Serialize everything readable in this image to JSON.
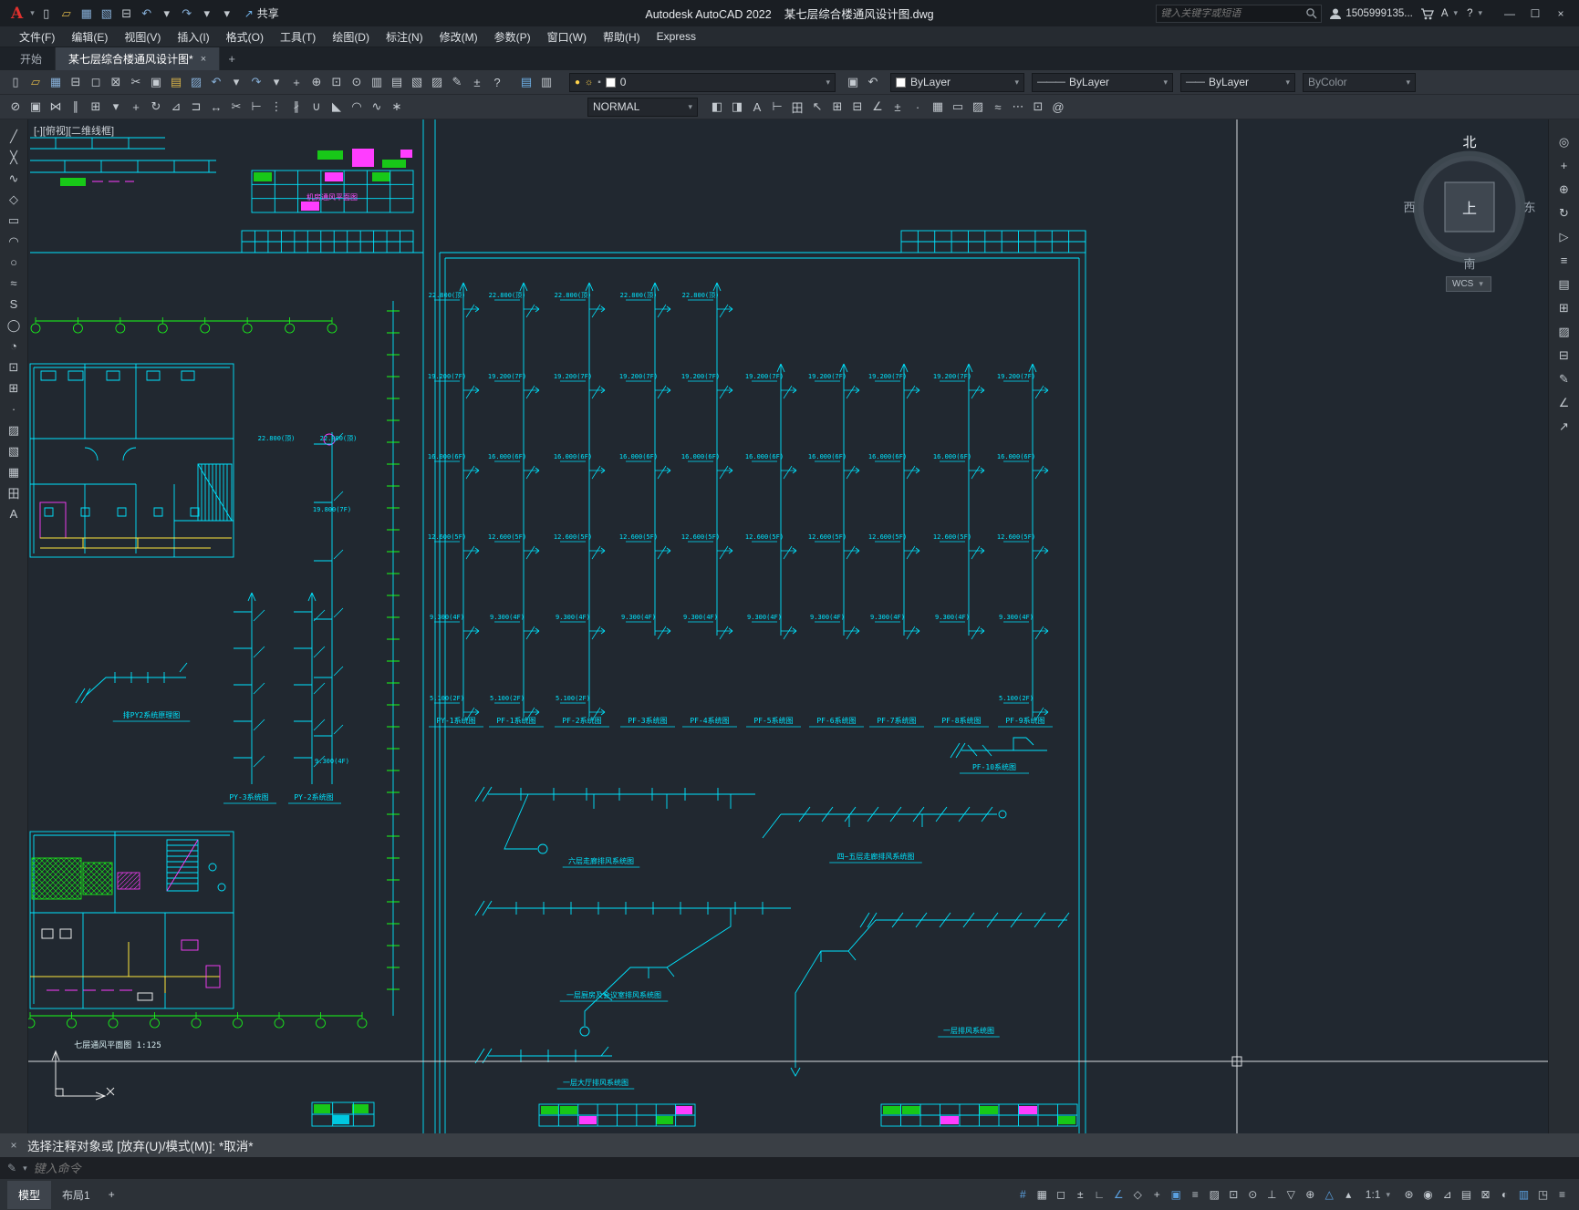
{
  "titlebar": {
    "app_title": "Autodesk AutoCAD 2022",
    "doc_title": "某七层综合楼通风设计图.dwg",
    "search_placeholder": "键入关键字或短语",
    "account": "1505999135...",
    "share_label": "共享",
    "qat_icons": [
      {
        "n": "new-file",
        "g": "▯"
      },
      {
        "n": "open-file",
        "g": "▱",
        "c": "#d9b44a"
      },
      {
        "n": "save-file",
        "g": "▦",
        "c": "#86aed6"
      },
      {
        "n": "save-as",
        "g": "▧",
        "c": "#86aed6"
      },
      {
        "n": "plot",
        "g": "⊟"
      },
      {
        "n": "undo",
        "g": "↶",
        "c": "#86aed6"
      },
      {
        "n": "undo-dropdown",
        "g": "▾"
      },
      {
        "n": "redo",
        "g": "↷",
        "c": "#86aed6"
      },
      {
        "n": "redo-dropdown",
        "g": "▾"
      },
      {
        "n": "qat-customize",
        "g": "▾"
      }
    ]
  },
  "menubar": {
    "items": [
      "文件(F)",
      "编辑(E)",
      "视图(V)",
      "插入(I)",
      "格式(O)",
      "工具(T)",
      "绘图(D)",
      "标注(N)",
      "修改(M)",
      "参数(P)",
      "窗口(W)",
      "帮助(H)",
      "Express"
    ]
  },
  "doctabs": {
    "start": "开始",
    "doc": "某七层综合楼通风设计图*",
    "close": "×",
    "add": "+"
  },
  "toolbars": {
    "layer_value": "0",
    "color_value": "ByLayer",
    "linetype_value": "ByLayer",
    "lineweight_value": "ByLayer",
    "plotstyle_value": "ByColor",
    "style_value": "NORMAL",
    "row1_icons": [
      {
        "n": "new-file",
        "g": "▯"
      },
      {
        "n": "open-file",
        "g": "▱",
        "c": "#d9b44a"
      },
      {
        "n": "save-file",
        "g": "▦",
        "c": "#86aed6"
      },
      {
        "n": "plot",
        "g": "⊟"
      },
      {
        "n": "plot-preview",
        "g": "◻"
      },
      {
        "n": "publish",
        "g": "⊠"
      },
      {
        "n": "cut-clip",
        "g": "✂"
      },
      {
        "n": "copy-clip",
        "g": "▣"
      },
      {
        "n": "paste-clip",
        "g": "▤",
        "c": "#d9b44a"
      },
      {
        "n": "match-properties",
        "g": "▨",
        "c": "#86aed6"
      },
      {
        "n": "undo",
        "g": "↶",
        "c": "#86aed6"
      },
      {
        "n": "undo-dropdown",
        "g": "▾"
      },
      {
        "n": "redo",
        "g": "↷",
        "c": "#86aed6"
      },
      {
        "n": "redo-dropdown",
        "g": "▾"
      },
      {
        "n": "pan-realtime",
        "g": "+"
      },
      {
        "n": "zoom-realtime",
        "g": "⊕"
      },
      {
        "n": "zoom-window",
        "g": "⊡"
      },
      {
        "n": "zoom-previous",
        "g": "⊙"
      },
      {
        "n": "properties-palette",
        "g": "▥"
      },
      {
        "n": "design-center",
        "g": "▤"
      },
      {
        "n": "tool-palettes",
        "g": "▧"
      },
      {
        "n": "sheet-set-manager",
        "g": "▨"
      },
      {
        "n": "markup-set-manager",
        "g": "✎"
      },
      {
        "n": "quick-calc",
        "g": "±"
      },
      {
        "n": "help",
        "g": "?"
      }
    ],
    "layer_tool_icons": [
      {
        "n": "layer-properties-manager",
        "g": "▤",
        "c": "#6fb1e8"
      },
      {
        "n": "layer-states",
        "g": "▥"
      }
    ],
    "post_layer_icons": [
      {
        "n": "make-object-layer-current",
        "g": "▣"
      },
      {
        "n": "layer-previous",
        "g": "↶"
      }
    ],
    "row2_icons": [
      {
        "n": "erase",
        "g": "⊘"
      },
      {
        "n": "copy",
        "g": "▣"
      },
      {
        "n": "mirror",
        "g": "⋈"
      },
      {
        "n": "offset",
        "g": "∥"
      },
      {
        "n": "array",
        "g": "⊞"
      },
      {
        "n": "array-dropdown",
        "g": "▾"
      },
      {
        "n": "move",
        "g": "+"
      },
      {
        "n": "rotate",
        "g": "↻"
      },
      {
        "n": "scale",
        "g": "⊿"
      },
      {
        "n": "stretch",
        "g": "⊐"
      },
      {
        "n": "lengthen",
        "g": "↔"
      },
      {
        "n": "trim",
        "g": "✂"
      },
      {
        "n": "extend",
        "g": "⊢"
      },
      {
        "n": "break-at-point",
        "g": "⋮"
      },
      {
        "n": "break",
        "g": "∦"
      },
      {
        "n": "join",
        "g": "∪"
      },
      {
        "n": "chamfer",
        "g": "◣"
      },
      {
        "n": "fillet",
        "g": "◠"
      },
      {
        "n": "blend-curves",
        "g": "∿"
      },
      {
        "n": "explode",
        "g": "∗"
      }
    ],
    "row2_right_icons": [
      {
        "n": "draw-order-front",
        "g": "◧"
      },
      {
        "n": "draw-order-back",
        "g": "◨"
      },
      {
        "n": "text-style",
        "g": "A"
      },
      {
        "n": "dimension-style",
        "g": "⊢"
      },
      {
        "n": "table-style",
        "g": "田"
      },
      {
        "n": "mleader-style",
        "g": "↖"
      },
      {
        "n": "group",
        "g": "⊞"
      },
      {
        "n": "ungroup",
        "g": "⊟"
      },
      {
        "n": "measure",
        "g": "∠"
      },
      {
        "n": "quick-calc",
        "g": "±"
      },
      {
        "n": "point-style",
        "g": "·"
      },
      {
        "n": "region-tool",
        "g": "▦"
      },
      {
        "n": "boundary",
        "g": "▭"
      },
      {
        "n": "wipeout",
        "g": "▨"
      },
      {
        "n": "revision-cloud",
        "g": "≈"
      },
      {
        "n": "divide",
        "g": "⋯"
      },
      {
        "n": "block-editor",
        "g": "⊡"
      },
      {
        "n": "attribute-editor",
        "g": "@"
      }
    ]
  },
  "left_toolbar": {
    "icons": [
      {
        "n": "line",
        "g": "╱"
      },
      {
        "n": "construction-line",
        "g": "╳"
      },
      {
        "n": "polyline",
        "g": "∿"
      },
      {
        "n": "polygon",
        "g": "◇"
      },
      {
        "n": "rectangle",
        "g": "▭"
      },
      {
        "n": "arc",
        "g": "◠"
      },
      {
        "n": "circle",
        "g": "○"
      },
      {
        "n": "revision-cloud",
        "g": "≈"
      },
      {
        "n": "spline",
        "g": "S"
      },
      {
        "n": "ellipse",
        "g": "◯"
      },
      {
        "n": "ellipse-arc",
        "g": "◔"
      },
      {
        "n": "insert-block",
        "g": "⊡"
      },
      {
        "n": "create-block",
        "g": "⊞"
      },
      {
        "n": "point",
        "g": "·"
      },
      {
        "n": "hatch",
        "g": "▨"
      },
      {
        "n": "gradient",
        "g": "▧"
      },
      {
        "n": "region",
        "g": "▦"
      },
      {
        "n": "table",
        "g": "田"
      },
      {
        "n": "mtext",
        "g": "A"
      }
    ]
  },
  "right_toolbar": {
    "icons": [
      {
        "n": "navigation-wheel",
        "g": "◎"
      },
      {
        "n": "pan",
        "g": "+"
      },
      {
        "n": "zoom",
        "g": "⊕"
      },
      {
        "n": "orbit",
        "g": "↻"
      },
      {
        "n": "show-motion",
        "g": "▷"
      },
      {
        "n": "layer-palette",
        "g": "≡"
      },
      {
        "n": "properties-palette",
        "g": "▤"
      },
      {
        "n": "blocks-palette",
        "g": "⊞"
      },
      {
        "n": "hatch-palette",
        "g": "▨"
      },
      {
        "n": "xref-palette",
        "g": "⊟"
      },
      {
        "n": "markup-palette",
        "g": "✎"
      },
      {
        "n": "measure-tool",
        "g": "∠"
      },
      {
        "n": "share-view",
        "g": "↗"
      }
    ]
  },
  "viewcube": {
    "north": "北",
    "south": "南",
    "east": "东",
    "west": "西",
    "top": "上",
    "wcs": "WCS"
  },
  "canvas": {
    "viewport_controls": "[-][俯视][二维线框]",
    "levels": [
      "22.800(顶)",
      "19.200(7F)",
      "16.000(6F)",
      "12.600(5F)",
      "9.300(4F)",
      "5.100(2F)"
    ],
    "riser_labels": [
      "PY-1系统图",
      "PF-1系统图",
      "PF-2系统图",
      "PF-3系统图",
      "PF-4系统图",
      "PF-5系统图",
      "PF-6系统图",
      "PF-7系统图",
      "PF-8系统图",
      "PF-9系统图"
    ],
    "left_elevations": [
      "22.800(顶)",
      "22.800(顶)",
      "19.800(7F)",
      "9.300(4F)"
    ],
    "labels": {
      "py3": "PY-3系统图",
      "py2": "PY-2系统图",
      "py2_schematic": "排PY2系统原理图",
      "pf10": "PF-10系统图",
      "sys_a": "六层走廊排风系统图",
      "sys_b": "四~五层走廊排风系统图",
      "sys_c": "一层厨房及会议室排风系统图",
      "sys_d": "一层排风系统图",
      "sys_e": "一层大厅排风系统图",
      "plan_title": "七层通风平面图 1:125",
      "plan_small": "机房通风平面图"
    }
  },
  "command": {
    "history": "选择注释对象或 [放弃(U)/模式(M)]: *取消*",
    "placeholder": "键入命令"
  },
  "statusbar": {
    "model": "模型",
    "layout1": "布局1",
    "add_layout": "+",
    "scale": "1:1",
    "icons_left": [
      {
        "n": "grid-display",
        "g": "#",
        "active": true
      },
      {
        "n": "snap-mode",
        "g": "▦"
      },
      {
        "n": "infer-constraints",
        "g": "◻"
      },
      {
        "n": "dynamic-input",
        "g": "±"
      },
      {
        "n": "ortho-mode",
        "g": "∟"
      },
      {
        "n": "polar-tracking",
        "g": "∠",
        "active": true
      },
      {
        "n": "isometric-drafting",
        "g": "◇"
      },
      {
        "n": "object-snap-tracking",
        "g": "+"
      },
      {
        "n": "object-snap",
        "g": "▣",
        "active": true
      },
      {
        "n": "lineweight-display",
        "g": "≡"
      },
      {
        "n": "transparency",
        "g": "▨"
      },
      {
        "n": "selection-cycling",
        "g": "⊡"
      },
      {
        "n": "3d-object-snap",
        "g": "⊙"
      },
      {
        "n": "dynamic-ucs",
        "g": "⊥"
      },
      {
        "n": "selection-filtering",
        "g": "▽"
      },
      {
        "n": "gizmo",
        "g": "⊕"
      },
      {
        "n": "annotation-visibility",
        "g": "△",
        "active": true
      },
      {
        "n": "autoscale",
        "g": "▴"
      }
    ],
    "icons_right": [
      {
        "n": "workspace-switching",
        "g": "⊛"
      },
      {
        "n": "annotation-monitor",
        "g": "◉"
      },
      {
        "n": "units",
        "g": "⊿"
      },
      {
        "n": "quick-properties",
        "g": "▤"
      },
      {
        "n": "lock-ui",
        "g": "⊠"
      },
      {
        "n": "isolate-objects",
        "g": "◐"
      },
      {
        "n": "graphics-performance",
        "g": "▥",
        "active": true
      },
      {
        "n": "clean-screen",
        "g": "◳"
      },
      {
        "n": "customization",
        "g": "≡"
      }
    ]
  }
}
